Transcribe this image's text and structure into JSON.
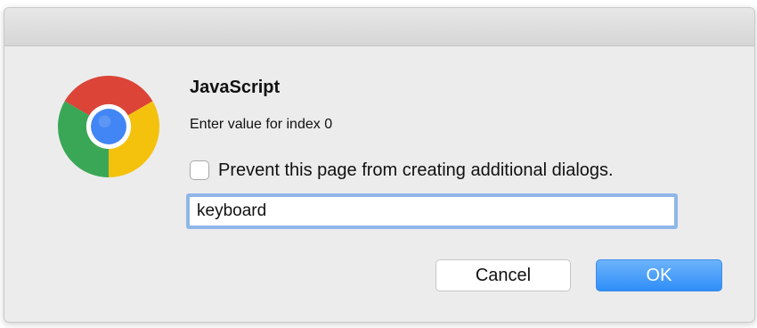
{
  "dialog": {
    "title": "JavaScript",
    "message": "Enter value for index 0",
    "checkbox": {
      "label": "Prevent this page from creating additional dialogs.",
      "checked": false
    },
    "input": {
      "value": "keyboard"
    },
    "buttons": {
      "cancel_label": "Cancel",
      "ok_label": "OK"
    },
    "icon": "chrome-logo-icon"
  },
  "colors": {
    "dialog_background": "#ececec",
    "focus_ring": "#8fb6e8",
    "ok_button": "#2f8ef8",
    "logo_red": "#db4437",
    "logo_yellow": "#f4c20d",
    "logo_green": "#3aa757",
    "logo_blue": "#4285f4"
  }
}
